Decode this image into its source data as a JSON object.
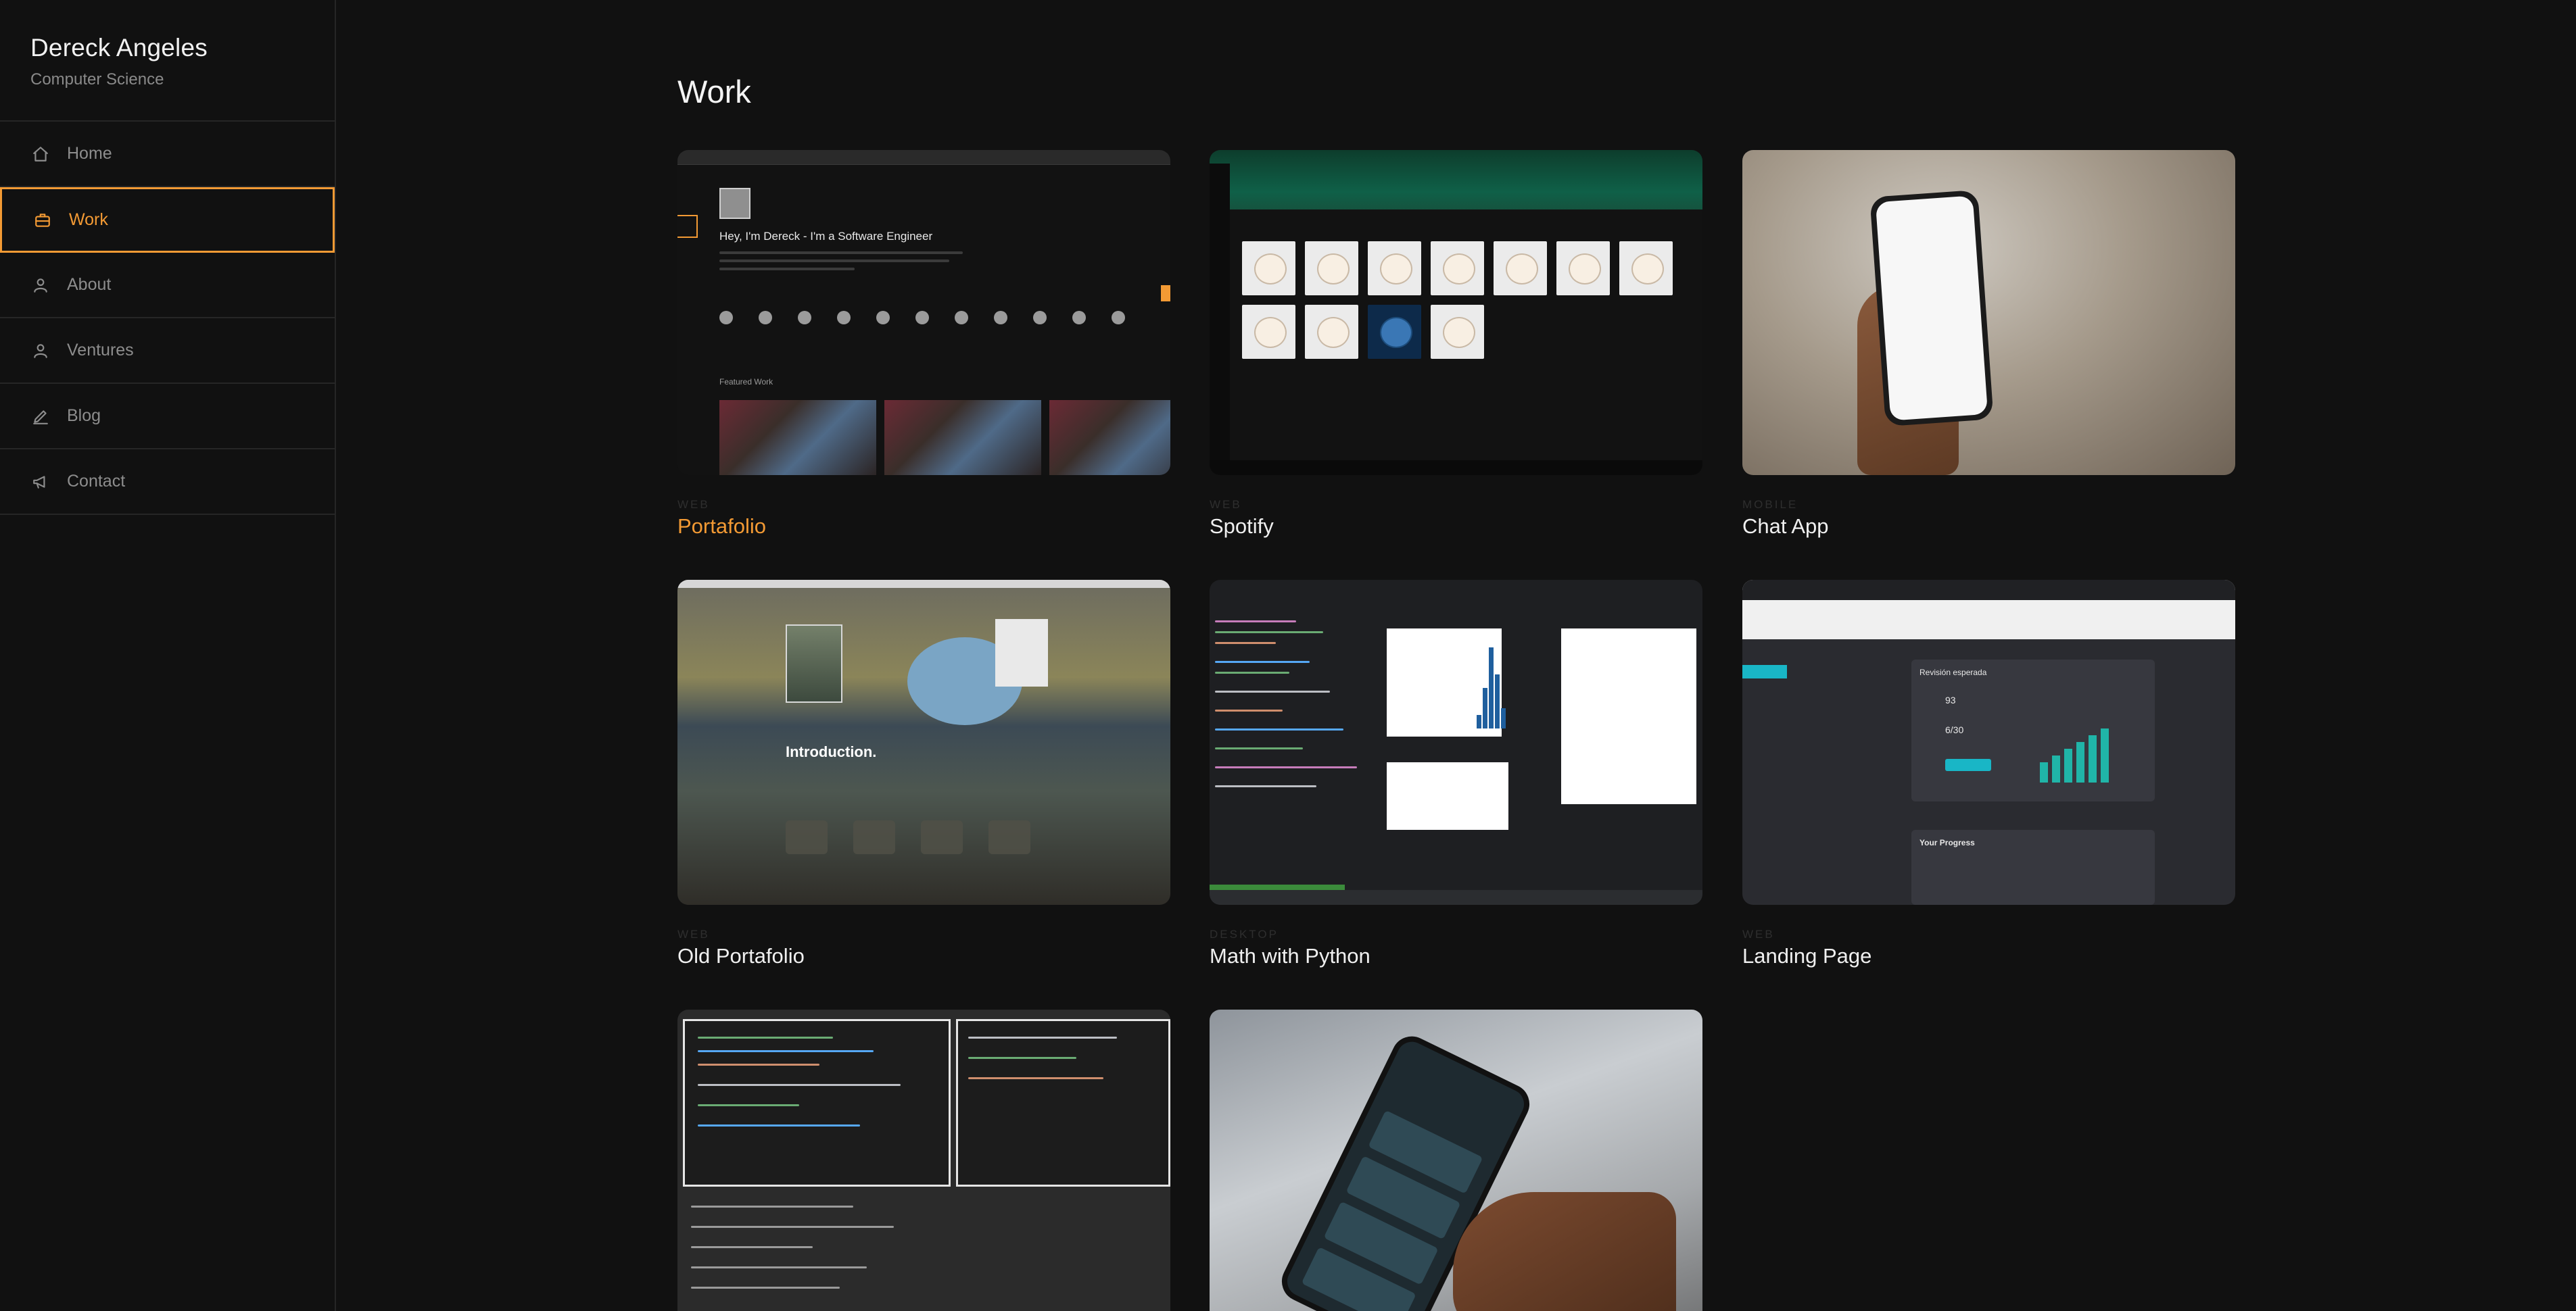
{
  "sidebar": {
    "name": "Dereck Angeles",
    "subtitle": "Computer Science",
    "items": [
      {
        "label": "Home",
        "icon": "home-icon"
      },
      {
        "label": "Work",
        "icon": "briefcase-icon",
        "active": true
      },
      {
        "label": "About",
        "icon": "user-icon"
      },
      {
        "label": "Ventures",
        "icon": "user-icon"
      },
      {
        "label": "Blog",
        "icon": "pencil-icon"
      },
      {
        "label": "Contact",
        "icon": "megaphone-icon"
      }
    ]
  },
  "main": {
    "title": "Work",
    "projects": [
      {
        "tag": "WEB",
        "title": "Portafolio"
      },
      {
        "tag": "WEB",
        "title": "Spotify"
      },
      {
        "tag": "MOBILE",
        "title": "Chat App"
      },
      {
        "tag": "WEB",
        "title": "Old Portafolio"
      },
      {
        "tag": "DESKTOP",
        "title": "Math with Python"
      },
      {
        "tag": "WEB",
        "title": "Landing Page"
      },
      {
        "tag": "",
        "title": ""
      },
      {
        "tag": "",
        "title": ""
      }
    ],
    "thumbnails": {
      "portafolio_headline": "Hey, I'm Dereck - I'm a Software Engineer",
      "portafolio_featured": "Featured Work",
      "old_portafolio_intro": "Introduction.",
      "landing_heading": "Revisión esperada",
      "landing_progress": "Your Progress",
      "landing_score": "93",
      "landing_ratio": "6/30"
    }
  },
  "colors": {
    "background": "#111111",
    "accent": "#f39a34",
    "divider": "#262626",
    "muted_text": "#8d8d8d"
  }
}
